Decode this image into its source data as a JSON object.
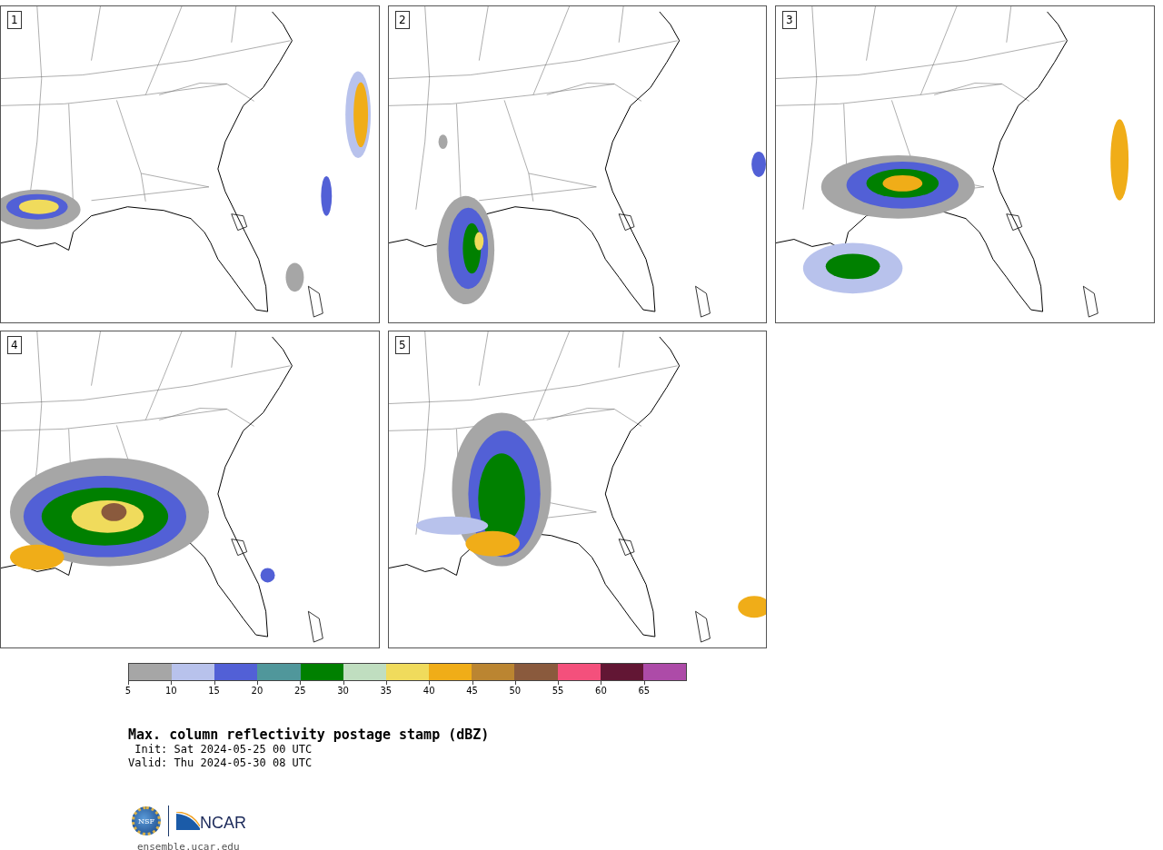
{
  "panels": [
    {
      "label": "1"
    },
    {
      "label": "2"
    },
    {
      "label": "3"
    },
    {
      "label": "4"
    },
    {
      "label": "5"
    }
  ],
  "colorbar": {
    "segments": [
      {
        "color": "#a6a6a6"
      },
      {
        "color": "#b8c2ec"
      },
      {
        "color": "#5260d6"
      },
      {
        "color": "#50979b"
      },
      {
        "color": "#008000"
      },
      {
        "color": "#c0dec0"
      },
      {
        "color": "#f0db5c"
      },
      {
        "color": "#f0ad18"
      },
      {
        "color": "#bb8531"
      },
      {
        "color": "#8a5a3d"
      },
      {
        "color": "#f4507c"
      },
      {
        "color": "#621634"
      },
      {
        "color": "#ad4ba8"
      }
    ],
    "ticks": [
      "5",
      "10",
      "15",
      "20",
      "25",
      "30",
      "35",
      "40",
      "45",
      "50",
      "55",
      "60",
      "65"
    ]
  },
  "title": "Max. column reflectivity postage stamp (dBZ)",
  "init": " Init: Sat 2024-05-25 00 UTC",
  "valid": "Valid: Thu 2024-05-30 08 UTC",
  "logo": {
    "left": "NSF",
    "right": "NCAR"
  },
  "url": "ensemble.ucar.edu"
}
